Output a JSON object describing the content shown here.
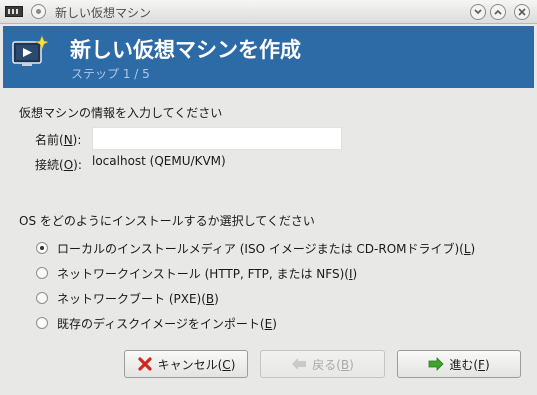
{
  "window": {
    "title": "新しい仮想マシン"
  },
  "header": {
    "heading": "新しい仮想マシンを作成",
    "step": "ステップ 1 / 5"
  },
  "form": {
    "section_title": "仮想マシンの情報を入力してください",
    "name_label_pre": "名前(",
    "name_mnemonic": "N",
    "name_label_post": "):",
    "name_value": "",
    "connection_label_pre": "接続(",
    "connection_mnemonic": "O",
    "connection_label_post": "):",
    "connection_value": "localhost (QEMU/KVM)"
  },
  "install": {
    "section_title": "OS をどのようにインストールするか選択してください",
    "selected": 0,
    "options": [
      {
        "label": "ローカルのインストールメディア (ISO イメージまたは CD-ROMドライブ)(",
        "mnemonic": "L",
        "suffix": ")"
      },
      {
        "label": "ネットワークインストール (HTTP, FTP, または NFS)(",
        "mnemonic": "I",
        "suffix": ")"
      },
      {
        "label": "ネットワークブート (PXE)(",
        "mnemonic": "B",
        "suffix": ")"
      },
      {
        "label": "既存のディスクイメージをインポート(",
        "mnemonic": "E",
        "suffix": ")"
      }
    ]
  },
  "buttons": {
    "cancel": {
      "pre": "キャンセル(",
      "mnemonic": "C",
      "post": ")",
      "icon": "red-x-icon",
      "color": "#d0281e"
    },
    "back": {
      "pre": "戻る(",
      "mnemonic": "B",
      "post": ")",
      "icon": "arrow-left-icon",
      "enabled": false
    },
    "forward": {
      "pre": "進む(",
      "mnemonic": "F",
      "post": ")",
      "icon": "arrow-right-icon",
      "color": "#3fa32b"
    }
  },
  "colors": {
    "header_bg": "#2d6ba6",
    "step_text": "#a9c9ec"
  }
}
